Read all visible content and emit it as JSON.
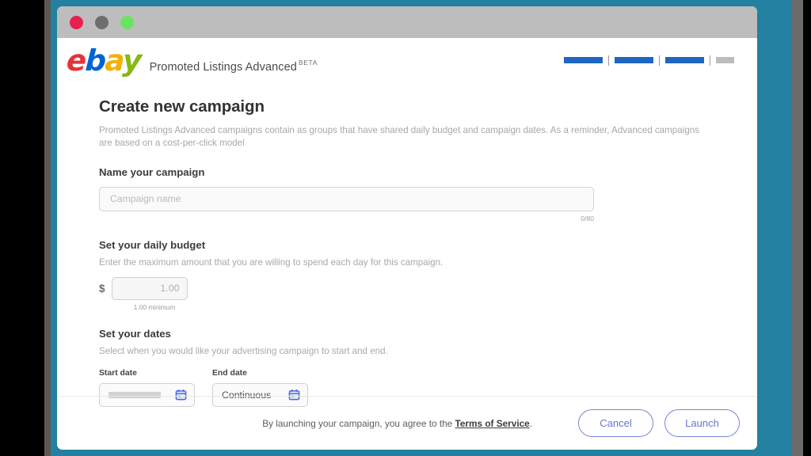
{
  "window": {
    "traffic_lights": [
      "close",
      "minimize",
      "maximize"
    ]
  },
  "header": {
    "logo_letters": [
      "e",
      "b",
      "a",
      "y"
    ],
    "logo_colors": {
      "e": "#e53238",
      "b": "#0064d2",
      "a": "#f5af02",
      "y": "#86b817"
    },
    "app_title": "Promoted Listings Advanced",
    "badge": "BETA",
    "nav_placeholders": [
      {
        "style": "blue"
      },
      {
        "style": "blue"
      },
      {
        "style": "blue"
      },
      {
        "style": "gray"
      }
    ]
  },
  "main": {
    "title": "Create new campaign",
    "description": "Promoted Listings Advanced campaigns contain as groups that have shared daily budget and campaign dates. As a reminder, Advanced campaigns are based on a cost-per-click model",
    "name_section": {
      "label": "Name your campaign",
      "placeholder": "Campaign name",
      "value": "",
      "char_count": "0/80"
    },
    "budget_section": {
      "label": "Set your daily budget",
      "description": "Enter the maximum amount that you are willing to spend each day for this campaign.",
      "currency_symbol": "$",
      "value": "1.00",
      "hint": "1.00 minimum"
    },
    "dates_section": {
      "label": "Set your dates",
      "description": "Select when you would like your advertising campaign to start and end.",
      "start_label": "Start date",
      "start_value": "",
      "end_label": "End date",
      "end_value": "Continuous",
      "calendar_icon_color": "#4169e1"
    }
  },
  "footer": {
    "terms_prefix": "By launching your campaign, you agree to the ",
    "terms_link": "Terms of Service",
    "terms_suffix": ".",
    "cancel_label": "Cancel",
    "launch_label": "Launch",
    "button_color": "#6a74cf"
  }
}
